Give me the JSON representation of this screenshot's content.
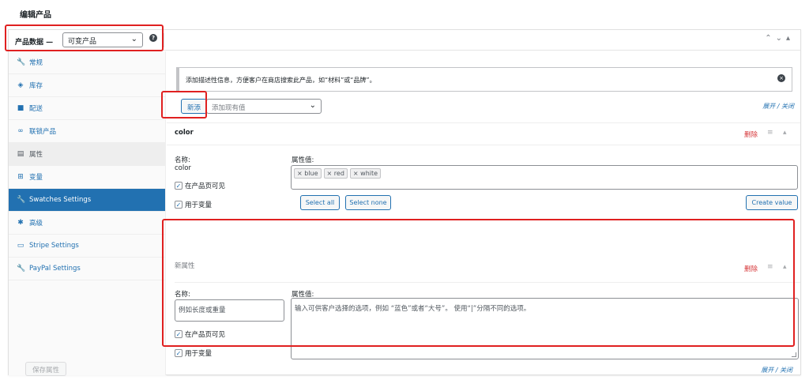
{
  "page_title": "编辑产品",
  "header": {
    "label": "产品数据 —",
    "product_type": "可变产品",
    "help": "?"
  },
  "tabs": [
    {
      "label": "常规",
      "icon": "wrench-icon"
    },
    {
      "label": "库存",
      "icon": "tag-icon"
    },
    {
      "label": "配送",
      "icon": "truck-icon"
    },
    {
      "label": "联锁产品",
      "icon": "link-icon"
    },
    {
      "label": "属性",
      "icon": "table-icon"
    },
    {
      "label": "变量",
      "icon": "grid-icon"
    },
    {
      "label": "Swatches Settings",
      "icon": "wrench-icon"
    },
    {
      "label": "高级",
      "icon": "gear-icon"
    },
    {
      "label": "Stripe Settings",
      "icon": "card-icon"
    },
    {
      "label": "PayPal Settings",
      "icon": "wrench-icon"
    }
  ],
  "notice": "添加描述性信息，方便客户在商店搜索此产品，如“材料”或“品牌”。",
  "toolbar": {
    "add_button": "新添",
    "existing_placeholder": "添加现有值",
    "expand_close": "展开 / 关闭"
  },
  "color_attr": {
    "title": "color",
    "remove": "删除",
    "name_label": "名称:",
    "name_value": "color",
    "values_label": "属性值:",
    "values": [
      "blue",
      "red",
      "white"
    ],
    "visible_label": "在产品页可见",
    "variation_label": "用于变量",
    "select_all": "Select all",
    "select_none": "Select none",
    "create_value": "Create value"
  },
  "new_attr": {
    "title": "新属性",
    "remove": "删除",
    "name_label": "名称:",
    "name_placeholder": "例如长度或重量",
    "values_label": "属性值:",
    "values_placeholder": "输入可供客户选择的选项，例如 “蓝色”或者“大号”。 使用“|”分隔不同的选项。",
    "visible_label": "在产品页可见",
    "variation_label": "用于变量"
  },
  "footer": {
    "save": "保存属性",
    "expand_close": "展开 / 关闭"
  },
  "colors": {
    "accent": "#2271b1",
    "highlight": "#e02020",
    "remove": "#d63638"
  }
}
